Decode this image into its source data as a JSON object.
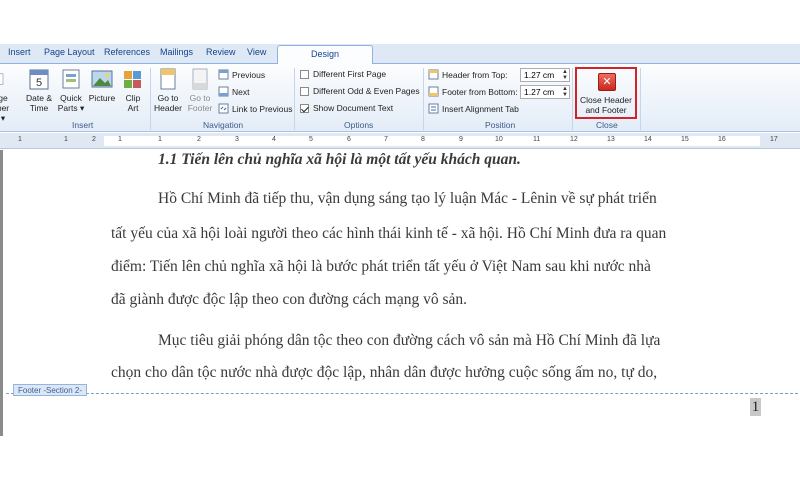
{
  "tabs": [
    "Insert",
    "Page Layout",
    "References",
    "Mailings",
    "Review",
    "View"
  ],
  "active_tab": "Design",
  "ribbon": {
    "insert_group": {
      "label": "Insert",
      "page_number_fragment": "ge",
      "page_number_fragment2": "ber",
      "date_time": [
        "Date &",
        "Time"
      ],
      "quick_parts": [
        "Quick",
        "Parts"
      ],
      "picture": "Picture",
      "clip_art": [
        "Clip",
        "Art"
      ]
    },
    "navigation_group": {
      "label": "Navigation",
      "go_to_header": [
        "Go to",
        "Header"
      ],
      "go_to_footer": [
        "Go to",
        "Footer"
      ],
      "previous": "Previous",
      "next": "Next",
      "link_to_previous": "Link to Previous"
    },
    "options_group": {
      "label": "Options",
      "different_first_page": "Different First Page",
      "different_odd_even": "Different Odd & Even Pages",
      "show_document_text": "Show Document Text",
      "show_document_text_checked": true
    },
    "position_group": {
      "label": "Position",
      "header_from_top_label": "Header from Top:",
      "header_from_top_value": "1.27 cm",
      "footer_from_bottom_label": "Footer from Bottom:",
      "footer_from_bottom_value": "1.27 cm",
      "insert_alignment_tab": "Insert Alignment Tab"
    },
    "close_group": {
      "label": "Close",
      "close_button": [
        "Close Header",
        "and Footer"
      ]
    }
  },
  "ruler": {
    "numbers": [
      "1",
      "1",
      "2",
      "1",
      "1",
      "2",
      "3",
      "4",
      "5",
      "6",
      "7",
      "8",
      "9",
      "10",
      "11",
      "12",
      "13",
      "14",
      "15",
      "16",
      "17"
    ]
  },
  "document": {
    "heading": "1.1 Tiến lên chủ nghĩa xã hội là một tất yếu khách quan.",
    "lines": [
      "Hồ Chí Minh đã tiếp thu, vận dụng sáng tạo lý luận Mác - Lênin về sự phát triển",
      "tất yếu của xã hội loài người theo các hình thái kinh tế - xã hội. Hồ Chí Minh đưa ra quan",
      "điểm: Tiến lên chủ nghĩa xã hội là bước phát triển tất yếu ở Việt Nam sau khi nước nhà",
      "đã giành được độc lập theo con đường cách mạng vô sản.",
      "Mục tiêu giải phóng dân tộc theo con đường cách vô sản mà Hồ Chí Minh đã lựa",
      "chọn cho dân tộc nước nhà được độc lập, nhân dân được hưởng cuộc sống ấm no, tự do,"
    ],
    "footer_tag": "Footer -Section 2-",
    "page_number": "1"
  },
  "colors": {
    "accent_red": "#d2232a",
    "ribbon_blue": "#15428b"
  }
}
